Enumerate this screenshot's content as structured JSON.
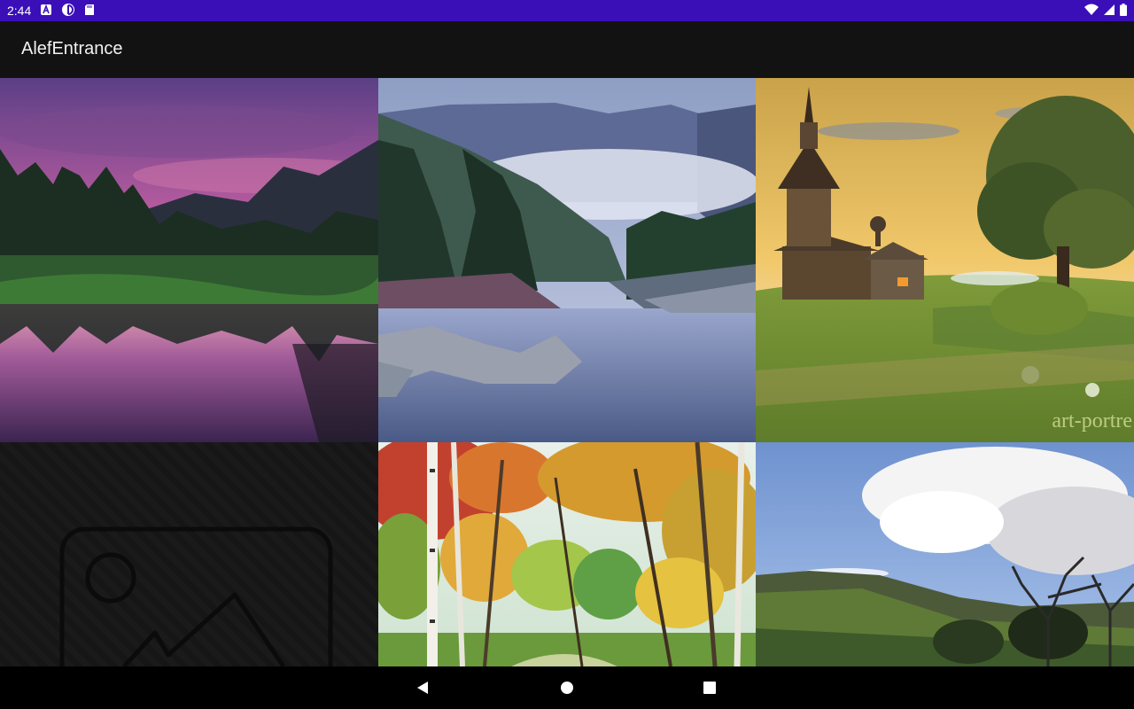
{
  "status_bar": {
    "time": "2:44",
    "left_icons": [
      "a-notification-icon",
      "cloud-sync-icon",
      "sd-card-icon"
    ],
    "right_icons": [
      "wifi-icon",
      "signal-icon",
      "battery-icon"
    ],
    "background": "#3a0fb7"
  },
  "app_bar": {
    "title": "AlefEntrance",
    "background": "#121212"
  },
  "gallery": {
    "tiles": [
      {
        "description": "sunset-lake-reflection"
      },
      {
        "description": "misty-mountain-river"
      },
      {
        "description": "wooden-church-painting",
        "watermark": "art-portre"
      },
      {
        "description": "image-placeholder"
      },
      {
        "description": "autumn-birch-forest"
      },
      {
        "description": "hills-cloudy-sky"
      }
    ]
  },
  "nav_bar": {
    "buttons": [
      "back-icon",
      "home-icon",
      "recents-icon"
    ]
  }
}
